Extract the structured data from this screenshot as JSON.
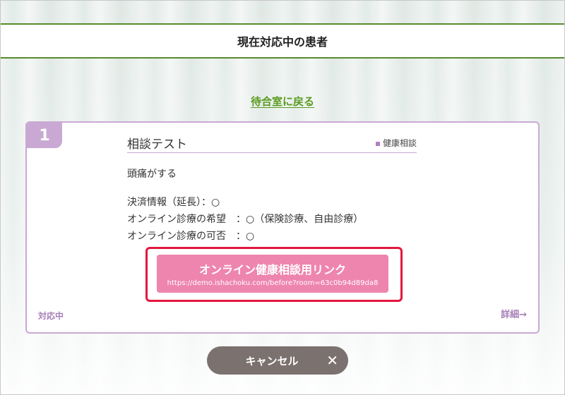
{
  "header": {
    "title": "現在対応中の患者"
  },
  "back_link": {
    "label": "待合室に戻る"
  },
  "card": {
    "number": "1",
    "title": "相談テスト",
    "category": "健康相談",
    "symptom": "頭痛がする",
    "info": [
      "決済情報（延長）：○",
      "オンライン診療の希望　：○（保険診療、自由診療）",
      "オンライン診療の可否　：○"
    ],
    "link_button": {
      "label": "オンライン健康相談用リンク",
      "url": "https://demo.ishachoku.com/before?room=63c0b94d89da8"
    },
    "status": "対応中",
    "detail": "詳細→"
  },
  "cancel_button": {
    "label": "キャンセル",
    "icon": "close-icon"
  },
  "colors": {
    "header_border": "#5a8a2e",
    "link_green": "#5b9a1e",
    "card_border": "#c9a9d3",
    "link_button": "#ee85ae",
    "highlight": "#e3163d",
    "cancel_button": "#7b716f"
  }
}
